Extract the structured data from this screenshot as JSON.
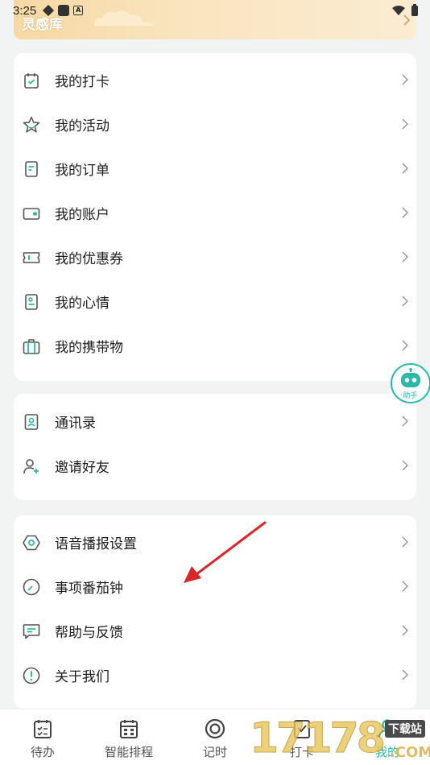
{
  "status_bar": {
    "time": "3:25"
  },
  "banner": {
    "title": "灵感库"
  },
  "group1": {
    "items": [
      {
        "label": "我的打卡",
        "icon": "calendar-check-icon"
      },
      {
        "label": "我的活动",
        "icon": "star-icon"
      },
      {
        "label": "我的订单",
        "icon": "document-icon"
      },
      {
        "label": "我的账户",
        "icon": "wallet-icon"
      },
      {
        "label": "我的优惠券",
        "icon": "ticket-icon"
      },
      {
        "label": "我的心情",
        "icon": "mood-note-icon"
      },
      {
        "label": "我的携带物",
        "icon": "suitcase-icon"
      }
    ]
  },
  "group2": {
    "items": [
      {
        "label": "通讯录",
        "icon": "contact-book-icon"
      },
      {
        "label": "邀请好友",
        "icon": "add-user-icon"
      }
    ]
  },
  "group3": {
    "items": [
      {
        "label": "语音播报设置",
        "icon": "hexagon-settings-icon"
      },
      {
        "label": "事项番茄钟",
        "icon": "clock-icon"
      },
      {
        "label": "帮助与反馈",
        "icon": "feedback-icon"
      },
      {
        "label": "关于我们",
        "icon": "info-icon"
      }
    ]
  },
  "assistant": {
    "label": "助手",
    "icon": "robot-icon"
  },
  "tabbar": {
    "tabs": [
      {
        "label": "待办",
        "icon": "todo-icon",
        "active": false
      },
      {
        "label": "智能排程",
        "icon": "schedule-icon",
        "active": false
      },
      {
        "label": "记时",
        "icon": "timer-icon",
        "active": false
      },
      {
        "label": "打卡",
        "icon": "checkin-icon",
        "active": false
      },
      {
        "label": "我的",
        "icon": "user-icon",
        "active": true
      }
    ]
  },
  "watermark": {
    "text": "17178",
    "sub": "下载站",
    "domain": ".COM"
  },
  "colors": {
    "accent": "#2bb9a6",
    "icon_gray": "#555555",
    "banner": "#f6d9a4",
    "arrow": "#d8262b"
  }
}
